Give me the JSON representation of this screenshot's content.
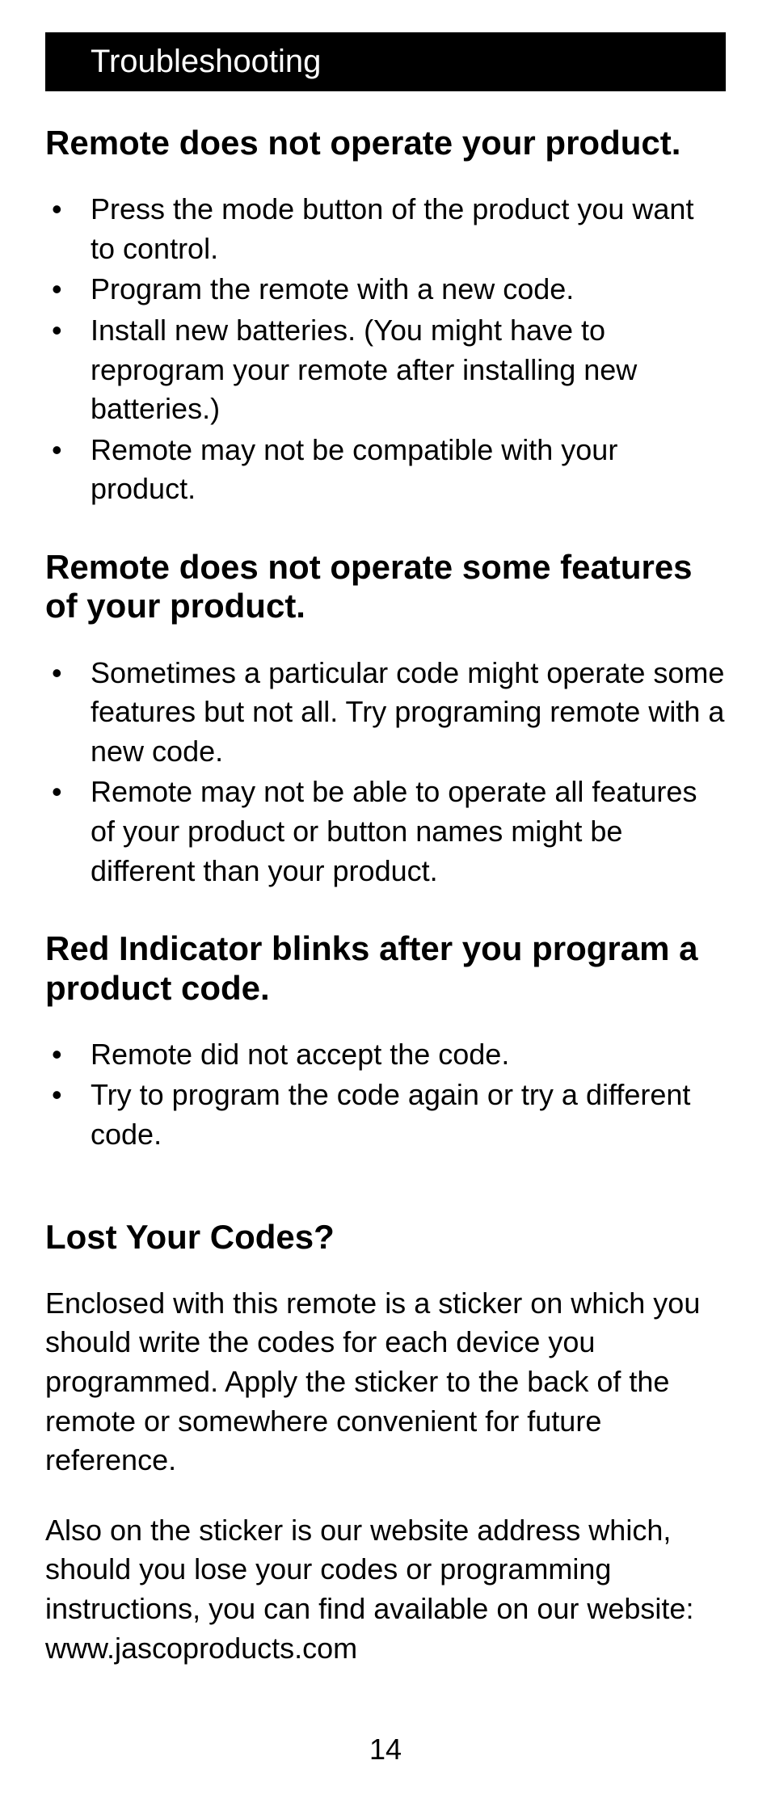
{
  "header": "Troubleshooting",
  "section1": {
    "title": "Remote does not operate your product.",
    "items": [
      "Press the mode button of the product you want to control.",
      "Program the remote with a new code.",
      "Install new batteries. (You might have to reprogram your remote after installing new batteries.)",
      "Remote may not be compatible with your product."
    ]
  },
  "section2": {
    "title": "Remote does not operate some features of your product.",
    "items": [
      "Sometimes a particular code might operate some features but not all. Try programing remote with a new code.",
      "Remote may not be able to operate all features of your product or button names might be different than your product."
    ]
  },
  "section3": {
    "title": "Red Indicator blinks after you program a product code.",
    "items": [
      "Remote did not accept the code.",
      "Try to program the code again or try a different code."
    ]
  },
  "section4": {
    "title": "Lost Your Codes?",
    "para1": "Enclosed with this remote is a sticker on which you should write the codes for each device you programmed. Apply the sticker to the back of the remote or somewhere convenient for future reference.",
    "para2": "Also on the sticker is our website address which, should you lose your codes or programming instructions, you can find available on our website: www.jascoproducts.com"
  },
  "pageNumber": "14"
}
